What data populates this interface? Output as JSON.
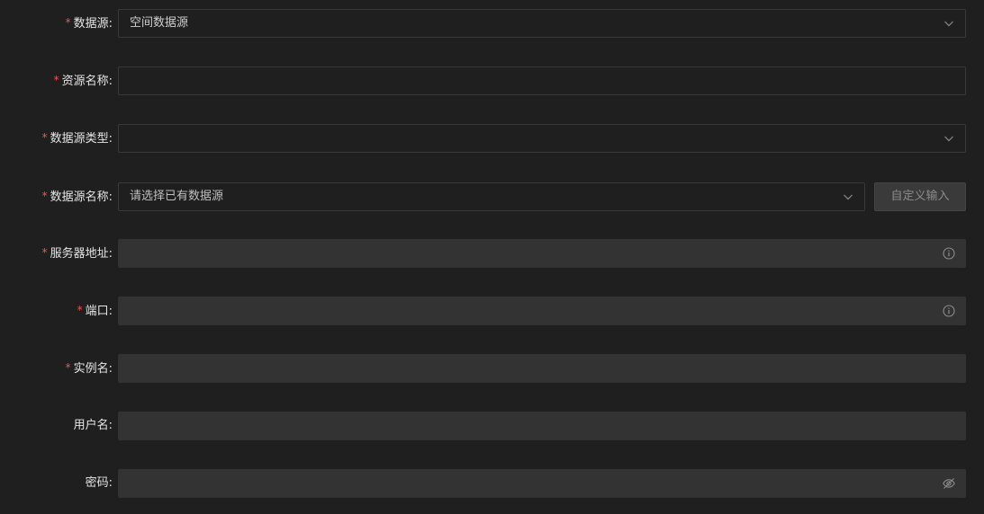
{
  "form": {
    "datasource": {
      "label": "数据源",
      "colon": ":",
      "required": true,
      "value": "空间数据源"
    },
    "resource_name": {
      "label": "资源名称",
      "colon": ":",
      "required": true,
      "value": ""
    },
    "datasource_type": {
      "label": "数据源类型",
      "colon": ":",
      "required": true,
      "value": ""
    },
    "datasource_name": {
      "label": "数据源名称",
      "colon": ":",
      "required": true,
      "placeholder": "请选择已有数据源",
      "custom_button": "自定义输入"
    },
    "server_address": {
      "label": "服务器地址",
      "colon": ":",
      "required": true,
      "value": "",
      "suffix_icon": "info-circle-icon"
    },
    "port": {
      "label": "端口",
      "colon": ":",
      "required": true,
      "value": "",
      "suffix_icon": "info-circle-icon"
    },
    "instance_name": {
      "label": "实例名",
      "colon": ":",
      "required": true,
      "value": ""
    },
    "username": {
      "label": "用户名",
      "colon": ":",
      "required": false,
      "value": ""
    },
    "password": {
      "label": "密码",
      "colon": ":",
      "required": false,
      "value": "",
      "suffix_icon": "eye-invisible-icon"
    }
  },
  "required_mark": "*",
  "colors": {
    "background": "#1f1f1f",
    "required": "#ff4d4f",
    "filled_input": "#333333",
    "border": "#3a3a3a"
  }
}
